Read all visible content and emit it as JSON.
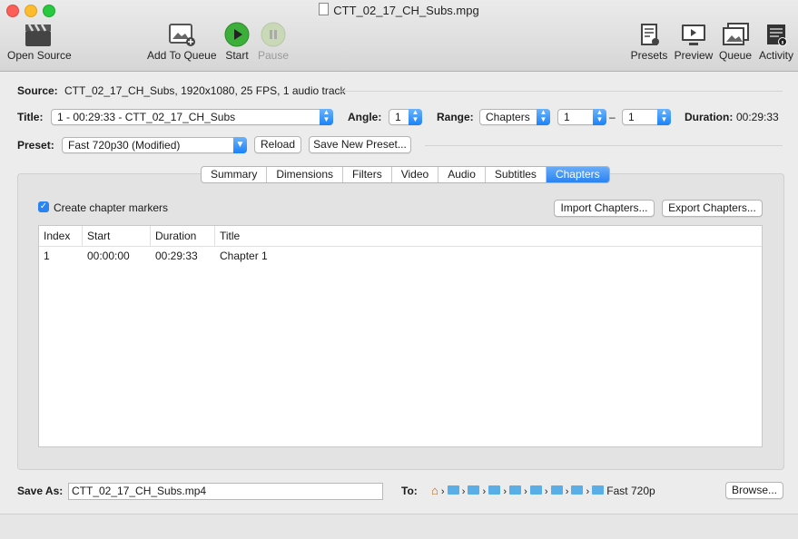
{
  "window": {
    "title": "CTT_02_17_CH_Subs.mpg"
  },
  "toolbar": {
    "open_source": "Open Source",
    "add_to_queue": "Add To Queue",
    "start": "Start",
    "pause": "Pause",
    "presets": "Presets",
    "preview": "Preview",
    "queue": "Queue",
    "activity": "Activity"
  },
  "source": {
    "label": "Source:",
    "value": "CTT_02_17_CH_Subs, 1920x1080, 25 FPS, 1 audio track"
  },
  "title_row": {
    "label": "Title:",
    "title_value": "1 - 00:29:33 - CTT_02_17_CH_Subs",
    "angle_label": "Angle:",
    "angle_value": "1",
    "range_label": "Range:",
    "range_type": "Chapters",
    "range_start": "1",
    "range_dash": "–",
    "range_end": "1",
    "duration_label": "Duration:",
    "duration_value": "00:29:33"
  },
  "preset_row": {
    "label": "Preset:",
    "value": "Fast 720p30 (Modified)",
    "reload": "Reload",
    "save_new": "Save New Preset..."
  },
  "tabs": [
    "Summary",
    "Dimensions",
    "Filters",
    "Video",
    "Audio",
    "Subtitles",
    "Chapters"
  ],
  "chapters": {
    "create_markers": "Create chapter markers",
    "checked": true,
    "import": "Import Chapters...",
    "export": "Export Chapters...",
    "columns": [
      "Index",
      "Start",
      "Duration",
      "Title"
    ],
    "rows": [
      [
        "1",
        "00:00:00",
        "00:29:33",
        "Chapter 1"
      ]
    ]
  },
  "save": {
    "label": "Save As:",
    "filename": "CTT_02_17_CH_Subs.mp4",
    "to_label": "To:",
    "path_last": "Fast 720p",
    "browse": "Browse..."
  },
  "colors": {
    "accent": "#2a83f1",
    "start_green": "#3cae3a"
  }
}
